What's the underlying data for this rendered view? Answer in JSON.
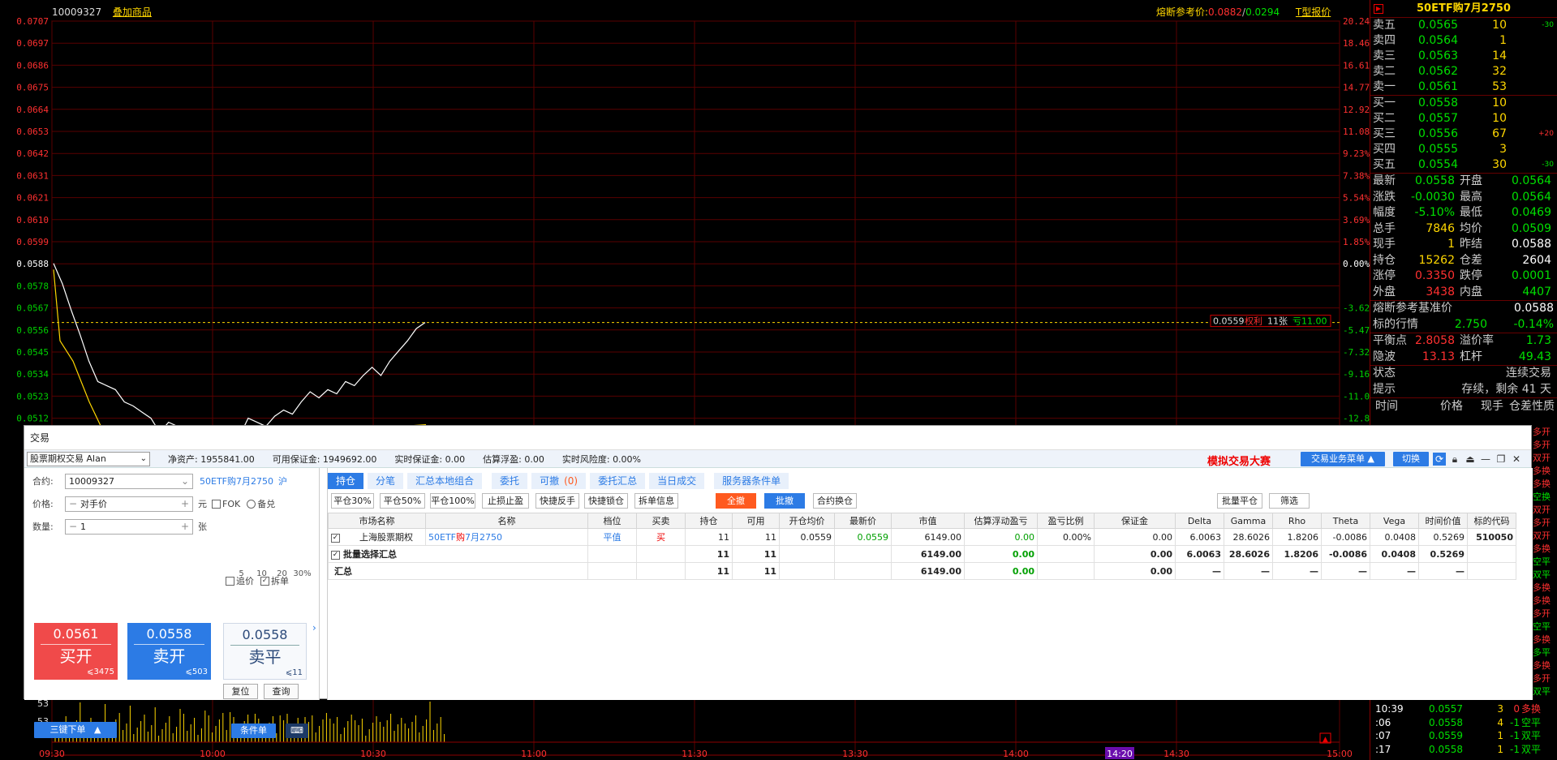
{
  "header": {
    "contract_code": "10009327",
    "overlay_label": "叠加商品",
    "circuit_label": "熔断参考价:",
    "circuit_val1": "0.0882",
    "circuit_slash": "/",
    "circuit_val2": "0.0294",
    "tquote_label": "T型报价"
  },
  "chart": {
    "y_left": [
      "0.0707",
      "0.0697",
      "0.0686",
      "0.0675",
      "0.0664",
      "0.0653",
      "0.0642",
      "0.0631",
      "0.0621",
      "0.0610",
      "0.0599",
      "0.0588",
      "0.0578",
      "0.0567",
      "0.0556",
      "0.0545",
      "0.0534",
      "0.0523",
      "0.0512"
    ],
    "y_right": [
      "20.24%",
      "18.46%",
      "16.61%",
      "14.77%",
      "12.92%",
      "11.08%",
      "9.23%",
      "7.38%",
      "5.54%",
      "3.69%",
      "1.85%",
      "0.00%",
      "-3.62%",
      "-5.47%",
      "-7.32%",
      "-9.16%",
      "-11.01%",
      "-12.85%"
    ],
    "price_tag": {
      "price": "0.0559",
      "side": "权利",
      "qty": "11张",
      "pnl": "亏11.00"
    },
    "vol_labels": [
      "53",
      "53"
    ],
    "x_labels": [
      "09:30",
      "10:00",
      "10:30",
      "11:00",
      "11:30",
      "13:30",
      "14:00",
      "14:20",
      "14:30",
      "15:00"
    ],
    "price_series": [
      0.0588,
      0.0578,
      0.0565,
      0.0553,
      0.054,
      0.053,
      0.0528,
      0.0526,
      0.052,
      0.0518,
      0.0515,
      0.0512,
      0.0505,
      0.051,
      0.0508,
      0.0503,
      0.05,
      0.0498,
      0.0502,
      0.0505,
      0.05,
      0.0503,
      0.0512,
      0.051,
      0.0508,
      0.0513,
      0.0516,
      0.0514,
      0.052,
      0.0525,
      0.0522,
      0.0526,
      0.0524,
      0.053,
      0.0528,
      0.0533,
      0.0537,
      0.0533,
      0.054,
      0.0545,
      0.055,
      0.0556,
      0.0559
    ]
  },
  "quote": {
    "title": "50ETF购7月2750",
    "asks": [
      {
        "label": "卖五",
        "price": "0.0565",
        "qty": "10",
        "chg": "-30"
      },
      {
        "label": "卖四",
        "price": "0.0564",
        "qty": "1",
        "chg": ""
      },
      {
        "label": "卖三",
        "price": "0.0563",
        "qty": "14",
        "chg": ""
      },
      {
        "label": "卖二",
        "price": "0.0562",
        "qty": "32",
        "chg": ""
      },
      {
        "label": "卖一",
        "price": "0.0561",
        "qty": "53",
        "chg": ""
      }
    ],
    "bids": [
      {
        "label": "买一",
        "price": "0.0558",
        "qty": "10",
        "chg": ""
      },
      {
        "label": "买二",
        "price": "0.0557",
        "qty": "10",
        "chg": ""
      },
      {
        "label": "买三",
        "price": "0.0556",
        "qty": "67",
        "chg": "+20"
      },
      {
        "label": "买四",
        "price": "0.0555",
        "qty": "3",
        "chg": ""
      },
      {
        "label": "买五",
        "price": "0.0554",
        "qty": "30",
        "chg": "-30"
      }
    ],
    "stats": [
      {
        "l1": "最新",
        "v1": "0.0558",
        "c1": "green",
        "l2": "开盘",
        "v2": "0.0564",
        "c2": "green"
      },
      {
        "l1": "涨跌",
        "v1": "-0.0030",
        "c1": "green",
        "l2": "最高",
        "v2": "0.0564",
        "c2": "green"
      },
      {
        "l1": "幅度",
        "v1": "-5.10%",
        "c1": "green",
        "l2": "最低",
        "v2": "0.0469",
        "c2": "green"
      },
      {
        "l1": "总手",
        "v1": "7846",
        "c1": "yellow",
        "l2": "均价",
        "v2": "0.0509",
        "c2": "green"
      },
      {
        "l1": "现手",
        "v1": "1",
        "c1": "yellow",
        "l2": "昨结",
        "v2": "0.0588",
        "c2": "white"
      },
      {
        "l1": "持仓",
        "v1": "15262",
        "c1": "yellow",
        "l2": "仓差",
        "v2": "2604",
        "c2": "white"
      },
      {
        "l1": "涨停",
        "v1": "0.3350",
        "c1": "red",
        "l2": "跌停",
        "v2": "0.0001",
        "c2": "green"
      },
      {
        "l1": "外盘",
        "v1": "3438",
        "c1": "red",
        "l2": "内盘",
        "v2": "4407",
        "c2": "green"
      }
    ],
    "circuit_base_label": "熔断参考基准价",
    "circuit_base_val": "0.0588",
    "underlying_label": "标的行情",
    "underlying_price": "2.750",
    "underlying_chg": "-0.14%",
    "balance_label": "平衡点",
    "balance_val": "2.8058",
    "premium_label": "溢价率",
    "premium_val": "1.73",
    "iv_label": "隐波",
    "iv_val": "13.13",
    "leverage_label": "杠杆",
    "leverage_val": "49.43",
    "status_label": "状态",
    "status_val": "连续交易",
    "hint_label": "提示",
    "hint_val": "存续，剩余 41 天",
    "tick_head": [
      "时间",
      "价格",
      "现手",
      "仓差性质"
    ],
    "side_flags": [
      "多开",
      "多开",
      "双开",
      "多换",
      "多换",
      "空换",
      "双开",
      "多开",
      "双开",
      "多换",
      "空平",
      "双平",
      "多换",
      "多换",
      "多开",
      "空平",
      "多换",
      "多平",
      "多换",
      "多开",
      "双平"
    ],
    "ticks": [
      {
        "time": "10:39",
        "price": "0.0557",
        "qty": "3",
        "oi": "0",
        "flag": "多换"
      },
      {
        "time": ":06",
        "price": "0.0558",
        "qty": "4",
        "oi": "-1",
        "flag": "空平"
      },
      {
        "time": ":07",
        "price": "0.0559",
        "qty": "1",
        "oi": "-1",
        "flag": "双平"
      },
      {
        "time": ":17",
        "price": "0.0558",
        "qty": "1",
        "oi": "-1",
        "flag": "双平"
      }
    ]
  },
  "trade": {
    "window_title": "交易",
    "account": "股票期权交易 Alan",
    "net_asset_label": "净资产:",
    "net_asset": "1955841.00",
    "avail_margin_label": "可用保证金:",
    "avail_margin": "1949692.00",
    "rt_margin_label": "实时保证金:",
    "rt_margin": "0.00",
    "float_pnl_label": "估算浮盈:",
    "float_pnl": "0.00",
    "risk_label": "实时风险度:",
    "risk": "0.00%",
    "contest": "模拟交易大赛",
    "biz_menu": "交易业务菜单",
    "switch": "切换",
    "contract_label": "合约:",
    "contract": "10009327",
    "contract_name": "50ETF购7月2750",
    "exchange": "沪",
    "price_label": "价格:",
    "price_value": "对手价",
    "yuan": "元",
    "fok": "FOK",
    "covered": "备兑",
    "qty_label": "数量:",
    "qty_value": "1",
    "zhang": "张",
    "pct_btns": [
      "5",
      "10",
      "20",
      "30%"
    ],
    "chase": "追价",
    "split": "拆单",
    "buy_open": {
      "price": "0.0561",
      "label": "买开",
      "qty": "⩽3475"
    },
    "sell_open": {
      "price": "0.0558",
      "label": "卖开",
      "qty": "⩽503"
    },
    "sell_close": {
      "price": "0.0558",
      "label": "卖平",
      "qty": "⩽11"
    },
    "reset": "复位",
    "query": "查询",
    "three_key": "三键下单",
    "cond_order": "条件单",
    "tabs": [
      "持仓",
      "分笔",
      "汇总本地组合",
      "委托",
      "可撤",
      "(0)",
      "委托汇总",
      "当日成交",
      "服务器条件单"
    ],
    "actions": [
      "平仓30%",
      "平仓50%",
      "平仓100%",
      "止损止盈",
      "快捷反手",
      "快捷锁仓",
      "拆单信息",
      "全撤",
      "批撤",
      "合约换仓",
      "批量平仓",
      "筛选"
    ],
    "columns": [
      "市场名称",
      "名称",
      "档位",
      "买卖",
      "持仓",
      "可用",
      "开仓均价",
      "最新价",
      "市值",
      "估算浮动盈亏",
      "盈亏比例",
      "保证金",
      "Delta",
      "Gamma",
      "Rho",
      "Theta",
      "Vega",
      "时间价值",
      "标的代码"
    ],
    "rows": [
      {
        "market": "上海股票期权",
        "name_pre": "50ETF",
        "name_mid": "购",
        "name_post": "7月2750",
        "level": "平值",
        "side": "买",
        "pos": "11",
        "avail": "11",
        "avg": "0.0559",
        "last": "0.0559",
        "mv": "6149.00",
        "pnl": "0.00",
        "ratio": "0.00%",
        "margin": "0.00",
        "delta": "6.0063",
        "gamma": "28.6026",
        "rho": "1.8206",
        "theta": "-0.0086",
        "vega": "0.0408",
        "tv": "0.5269",
        "code": "510050"
      }
    ],
    "sum_rows": [
      {
        "label": "批量选择汇总",
        "pos": "11",
        "avail": "11",
        "mv": "6149.00",
        "pnl": "0.00",
        "margin": "0.00",
        "delta": "6.0063",
        "gamma": "28.6026",
        "rho": "1.8206",
        "theta": "-0.0086",
        "vega": "0.0408",
        "tv": "0.5269"
      },
      {
        "label": "汇总",
        "pos": "11",
        "avail": "11",
        "mv": "6149.00",
        "pnl": "0.00",
        "margin": "0.00",
        "delta": "—",
        "gamma": "—",
        "rho": "—",
        "theta": "—",
        "vega": "—",
        "tv": "—"
      }
    ]
  }
}
